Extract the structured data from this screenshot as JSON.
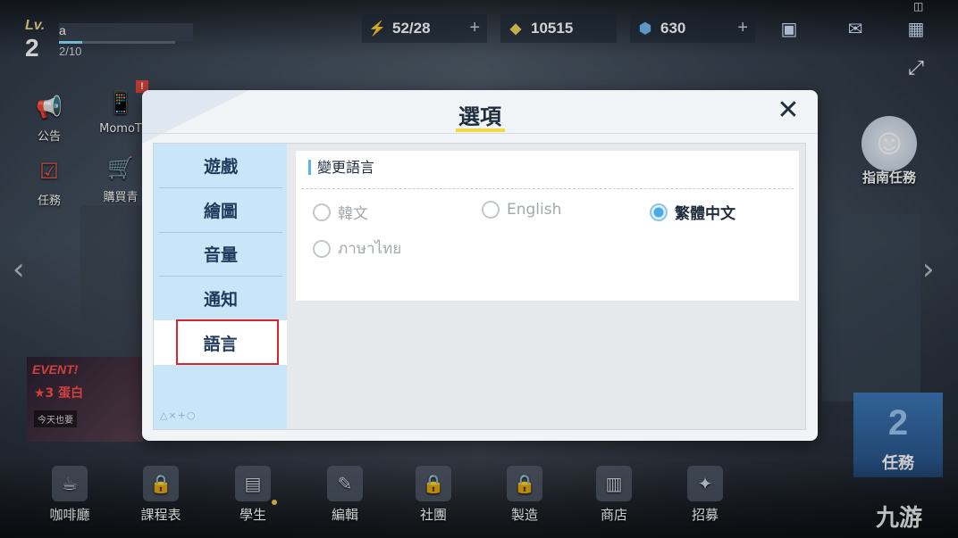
{
  "player": {
    "lv_label": "Lv.",
    "level": "2",
    "name": "a",
    "exp": "2/10",
    "exp_fraction": 0.2
  },
  "resources": [
    {
      "icon": "lightning-icon",
      "value": "52/28",
      "has_plus": true
    },
    {
      "icon": "credit-icon",
      "value": "10515",
      "has_plus": false
    },
    {
      "icon": "gem-icon",
      "value": "630",
      "has_plus": true
    }
  ],
  "top_icons": [
    "profile-card-icon",
    "mail-icon",
    "grid-menu-icon"
  ],
  "side_left": [
    {
      "label": "公告",
      "icon": "megaphone-icon",
      "badge": ""
    },
    {
      "label": "MomoT",
      "icon": "phone-icon",
      "badge": "!"
    },
    {
      "label": "任務",
      "icon": "checklist-icon",
      "badge": ""
    },
    {
      "label": "購買青",
      "icon": "cart-icon",
      "badge": ""
    }
  ],
  "event": {
    "tag": "EVENT!",
    "title": "★3 蛋白",
    "sub": "今天也要"
  },
  "guide": {
    "label": "指南任務"
  },
  "task": {
    "number": "2",
    "label": "任務"
  },
  "bottom_nav": [
    {
      "label": "咖啡廳",
      "icon": "cafe-icon"
    },
    {
      "label": "課程表",
      "icon": "lock-icon"
    },
    {
      "label": "學生",
      "icon": "student-icon"
    },
    {
      "label": "編輯",
      "icon": "edit-icon"
    },
    {
      "label": "社團",
      "icon": "lock-icon"
    },
    {
      "label": "製造",
      "icon": "lock-icon"
    },
    {
      "label": "商店",
      "icon": "shop-icon"
    },
    {
      "label": "招募",
      "icon": "recruit-icon"
    }
  ],
  "watermark": "九游",
  "dialog": {
    "title": "選項",
    "close_glyph": "✕",
    "tabs": [
      {
        "label": "遊戲",
        "active": false
      },
      {
        "label": "繪圖",
        "active": false
      },
      {
        "label": "音量",
        "active": false
      },
      {
        "label": "通知",
        "active": false
      },
      {
        "label": "語言",
        "active": true
      }
    ],
    "shapes_glyphs": "△×+○",
    "section_title": "變更語言",
    "languages": [
      {
        "label": "韓文",
        "selected": false
      },
      {
        "label": "English",
        "selected": false
      },
      {
        "label": "繁體中文",
        "selected": true
      },
      {
        "label": "ภาษาไทย",
        "selected": false
      }
    ]
  },
  "colors": {
    "accent": "#4aa9e8",
    "tab_bg": "#c9e6f9",
    "highlight": "#d9262e",
    "title_underline": "#f1d743"
  }
}
